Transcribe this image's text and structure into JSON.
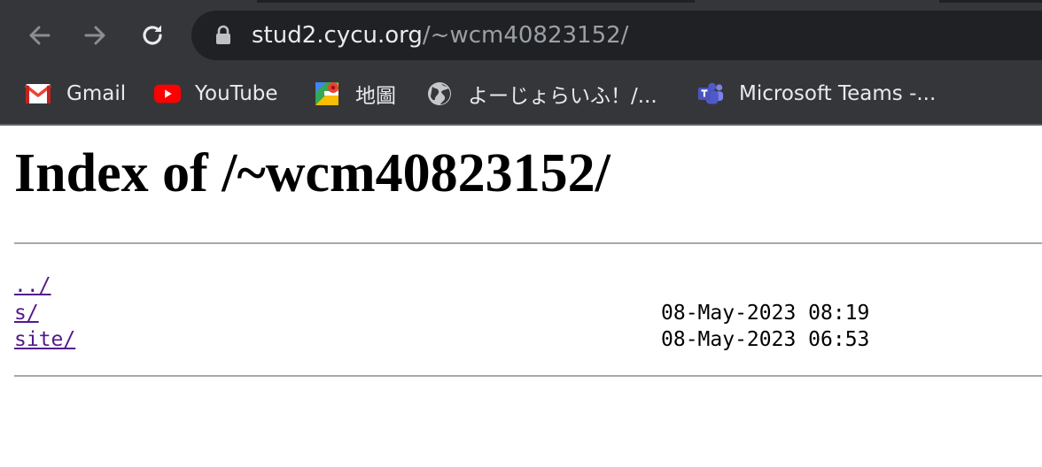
{
  "browser": {
    "url_host": "stud2.cycu.org",
    "url_path": "/~wcm40823152/",
    "bookmarks": [
      {
        "label": "Gmail",
        "icon": "gmail-icon"
      },
      {
        "label": "YouTube",
        "icon": "youtube-icon"
      },
      {
        "label": "地圖",
        "icon": "maps-icon"
      },
      {
        "label": "よーじょらいふ！/...",
        "icon": "globe-icon"
      },
      {
        "label": "Microsoft Teams -...",
        "icon": "teams-icon"
      }
    ]
  },
  "page": {
    "heading": "Index of /~wcm40823152/",
    "entries": [
      {
        "name": "../",
        "date": ""
      },
      {
        "name": "s/",
        "date": "08-May-2023 08:19"
      },
      {
        "name": "site/",
        "date": "08-May-2023 06:53"
      }
    ]
  }
}
